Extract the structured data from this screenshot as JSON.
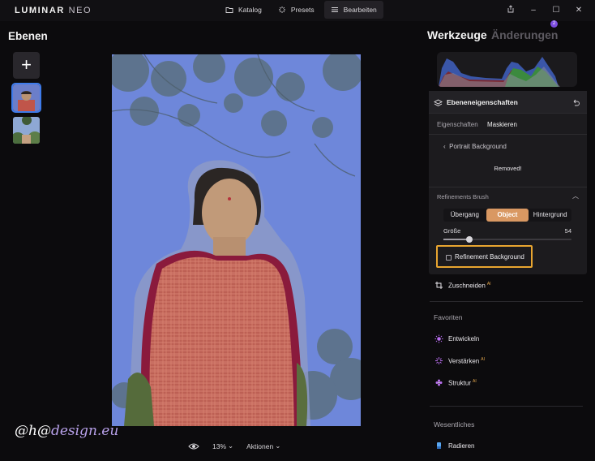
{
  "app": {
    "logo_main": "LUMINAR",
    "logo_sub": "NEO"
  },
  "topbar": {
    "tabs": [
      {
        "label": "Katalog",
        "icon": "folder-icon"
      },
      {
        "label": "Presets",
        "icon": "sparkle-icon"
      },
      {
        "label": "Bearbeiten",
        "icon": "sliders-icon",
        "active": true
      }
    ],
    "window_controls": [
      "share-icon",
      "minimize-icon",
      "maximize-icon",
      "close-icon"
    ]
  },
  "left_panel": {
    "title": "Ebenen",
    "add_layer_symbol": "+",
    "layers": [
      {
        "name": "portrait-layer",
        "selected": true
      },
      {
        "name": "tree-layer",
        "selected": false
      }
    ]
  },
  "canvas_bar": {
    "zoom": "13%",
    "actions_label": "Aktionen"
  },
  "watermark": {
    "prefix": "@h@",
    "suffix": "design.eu"
  },
  "right_panel": {
    "title": "Werkzeuge",
    "changes_title": "Änderungen",
    "changes_badge": "2",
    "layer_props": {
      "title": "Ebeneneigenschaften",
      "subtabs": [
        "Eigenschaften",
        "Maskieren"
      ],
      "active_subtab": "Maskieren",
      "mask_item": "Portrait Background",
      "status": "Removed!",
      "refinement": {
        "title": "Refinements Brush",
        "modes": [
          "Übergang",
          "Object",
          "Hintergrund"
        ],
        "active_mode": "Object",
        "size_label": "Größe",
        "size_value": "54",
        "size_fraction": 0.2,
        "checkbox_label": "Refinement Background",
        "checkbox_checked": false
      }
    },
    "crop_tool": {
      "label": "Zuschneiden",
      "badge": "AI"
    },
    "favorites": {
      "title": "Favoriten",
      "items": [
        {
          "label": "Entwickeln",
          "badge": "",
          "icon": "sun-icon"
        },
        {
          "label": "Verstärken",
          "badge": "AI",
          "icon": "sparkle-icon"
        },
        {
          "label": "Struktur",
          "badge": "AI",
          "icon": "flower-icon"
        }
      ]
    },
    "essentials": {
      "title": "Wesentliches",
      "items": [
        {
          "label": "Radieren",
          "icon": "eraser-icon"
        }
      ]
    }
  },
  "colors": {
    "accent_orange": "#d99862",
    "highlight_box": "#e8a530",
    "selection_blue": "#3e7bea",
    "mask_blue": "#6d86d8",
    "badge_purple": "#7c4de0"
  }
}
